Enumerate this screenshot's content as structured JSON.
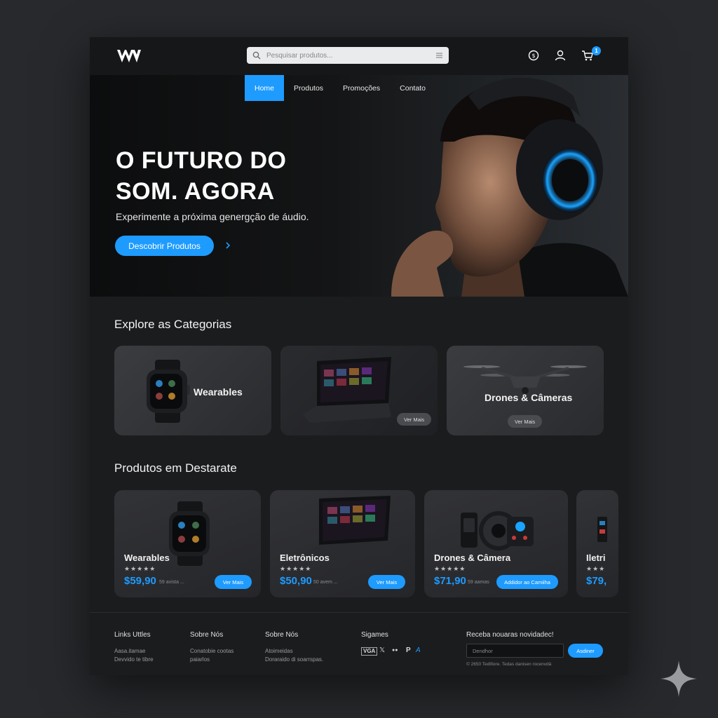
{
  "header": {
    "search_placeholder": "Pesquisar produtos...",
    "cart_count": "1"
  },
  "nav": {
    "items": [
      {
        "label": "Home",
        "active": true
      },
      {
        "label": "Produtos"
      },
      {
        "label": "Promoções"
      },
      {
        "label": "Contato"
      }
    ]
  },
  "hero": {
    "title_line1": "O FUTURO DO",
    "title_line2": "SOM. AGORA",
    "subtitle": "Experimente a próxima genergção de áudio.",
    "cta_label": "Descobrir Produtos"
  },
  "categories": {
    "title": "Explore as Categorias",
    "items": [
      {
        "label": "Wearables"
      },
      {
        "label": "",
        "button": "Ver Mais"
      },
      {
        "label": "Drones & Câmeras",
        "button": "Ver Mais"
      }
    ]
  },
  "featured": {
    "title": "Produtos em Destarate",
    "items": [
      {
        "name": "Wearables",
        "stars": "★★★★★",
        "price": "$59,90",
        "note": "59 avista ...",
        "button": "Ver Mais"
      },
      {
        "name": "Eletrônicos",
        "stars": "★★★★★",
        "price": "$50,90",
        "note": "50 avem ...",
        "button": "Ver Mais"
      },
      {
        "name": "Drones & Câmera",
        "stars": "★★★★★",
        "price": "$71,90",
        "note": "59 aamas",
        "button": "Addidor ao Camiiha"
      },
      {
        "name": "Iletri",
        "stars": "★★★",
        "price": "$79,"
      }
    ]
  },
  "footer": {
    "col1": {
      "title": "Links Uttles",
      "links": [
        "Aasa.itamae",
        "Devvido te tibre"
      ]
    },
    "col2": {
      "title": "Sobre Nós",
      "links": [
        "Conatobie cootas",
        "paiarlos"
      ]
    },
    "col3": {
      "title": "Sobre Nós",
      "links": [
        "Atoimeidas",
        "Doraraido di soarrspas."
      ]
    },
    "col4": {
      "title": "Sigames",
      "icons": [
        "VGA",
        "𝕏",
        "●●",
        "P",
        "A"
      ]
    },
    "newsletter": {
      "title": "Receba nouaras novidadec!",
      "placeholder": "Dendhor",
      "button": "Asdiner",
      "copyright": "© 2650 Tedifiore. Tedas danisen rocenvdä"
    }
  },
  "colors": {
    "accent": "#1e9bff",
    "page_bg": "#27292c",
    "card_bg": "#2f3033"
  }
}
